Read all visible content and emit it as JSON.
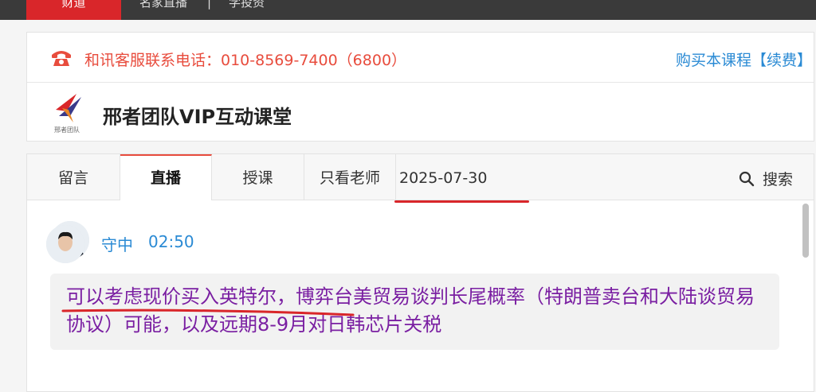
{
  "topnav": {
    "active_label": "财道",
    "items": [
      "名家直播",
      "|",
      "学投资"
    ]
  },
  "hotline": {
    "text": "和讯客服联系电话：010-8569-7400（6800）",
    "buy_link": "购买本课程【续费】"
  },
  "course": {
    "logo_caption": "邢者团队",
    "title": "邢者团队VIP互动课堂"
  },
  "tabs": [
    {
      "label": "留言"
    },
    {
      "label": "直播"
    },
    {
      "label": "授课"
    },
    {
      "label": "只看老师"
    }
  ],
  "date_filter": "2025-07-30",
  "search_label": "搜索",
  "messages": [
    {
      "author": "守中",
      "time": "02:50",
      "text": "可以考虑现价买入英特尔，博弈台美贸易谈判长尾概率（特朗普卖台和大陆谈贸易协议）可能，以及远期8-9月对日韩芯片关税"
    }
  ],
  "colors": {
    "accent_red": "#d9262a",
    "hotline_red": "#e84c3d",
    "link_blue": "#2a8ad4",
    "message_purple": "#7a1fa2"
  }
}
